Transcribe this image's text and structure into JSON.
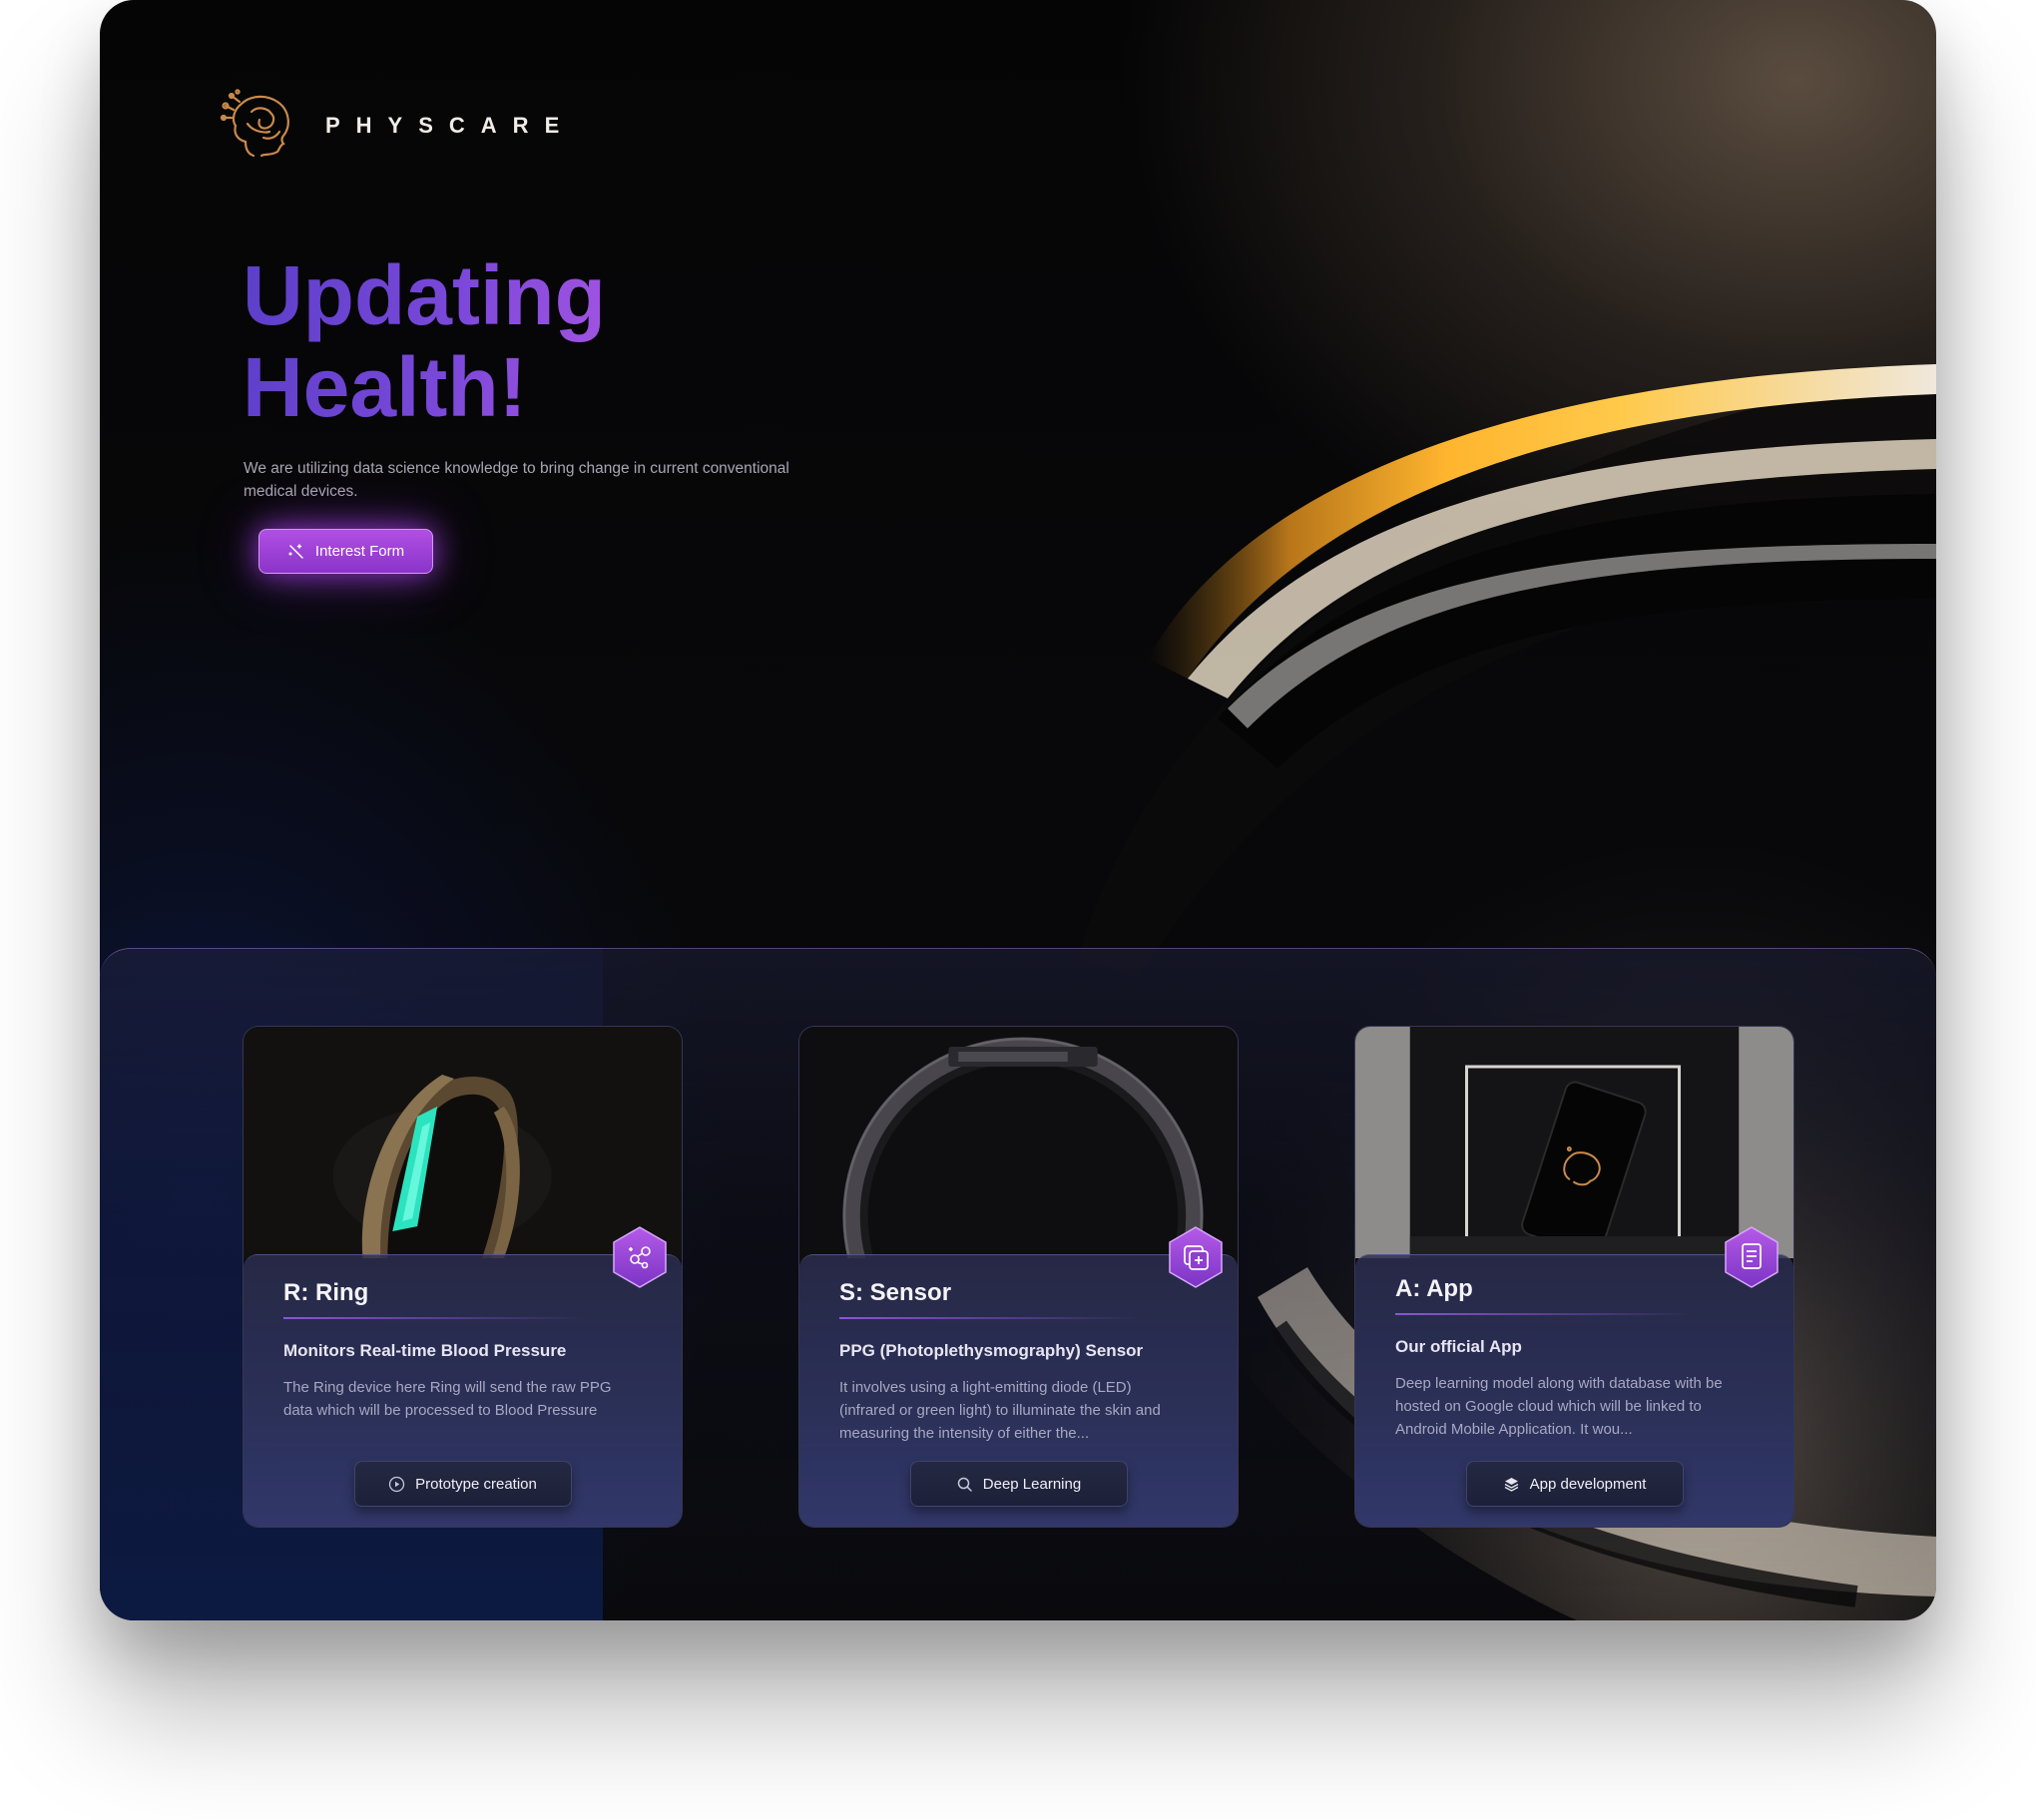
{
  "brand": {
    "name": "PHYSCARE",
    "logo_icon": "brain-head-icon"
  },
  "hero": {
    "title_line1": "Updating",
    "title_line2": "Health!",
    "subtitle": "We are utilizing data science knowledge to bring change in current conventional medical devices.",
    "cta_label": "Interest Form",
    "cta_icon": "magic-wand-icon"
  },
  "cards": [
    {
      "letter_title": "R: Ring",
      "subtitle": "Monitors Real-time Blood Pressure",
      "description": "The Ring device here Ring will send the raw PPG data which will be processed to Blood Pressure",
      "button_label": "Prototype creation",
      "button_icon": "play-circle-icon",
      "badge_icon": "molecule-icon"
    },
    {
      "letter_title": "S: Sensor",
      "subtitle": "PPG (Photoplethysmography) Sensor",
      "description": "It involves using a light-emitting diode (LED) (infrared or green light) to illuminate the skin and measuring the intensity of either the...",
      "button_label": "Deep Learning",
      "button_icon": "search-icon",
      "badge_icon": "image-plus-icon"
    },
    {
      "letter_title": "A: App",
      "subtitle": "Our official App",
      "description": "Deep learning model along with database with be hosted on Google cloud which will be linked to Android Mobile Application. It wou...",
      "button_label": "App development",
      "button_icon": "layers-icon",
      "badge_icon": "document-icon"
    }
  ],
  "colors": {
    "accent_purple": "#9b45d8",
    "title_gradient_start": "#5b3fc9",
    "title_gradient_end": "#c76ae9",
    "ring_gold": "#f0a42c",
    "card_body": "#2e3460",
    "logo_copper": "#c98a4b"
  }
}
